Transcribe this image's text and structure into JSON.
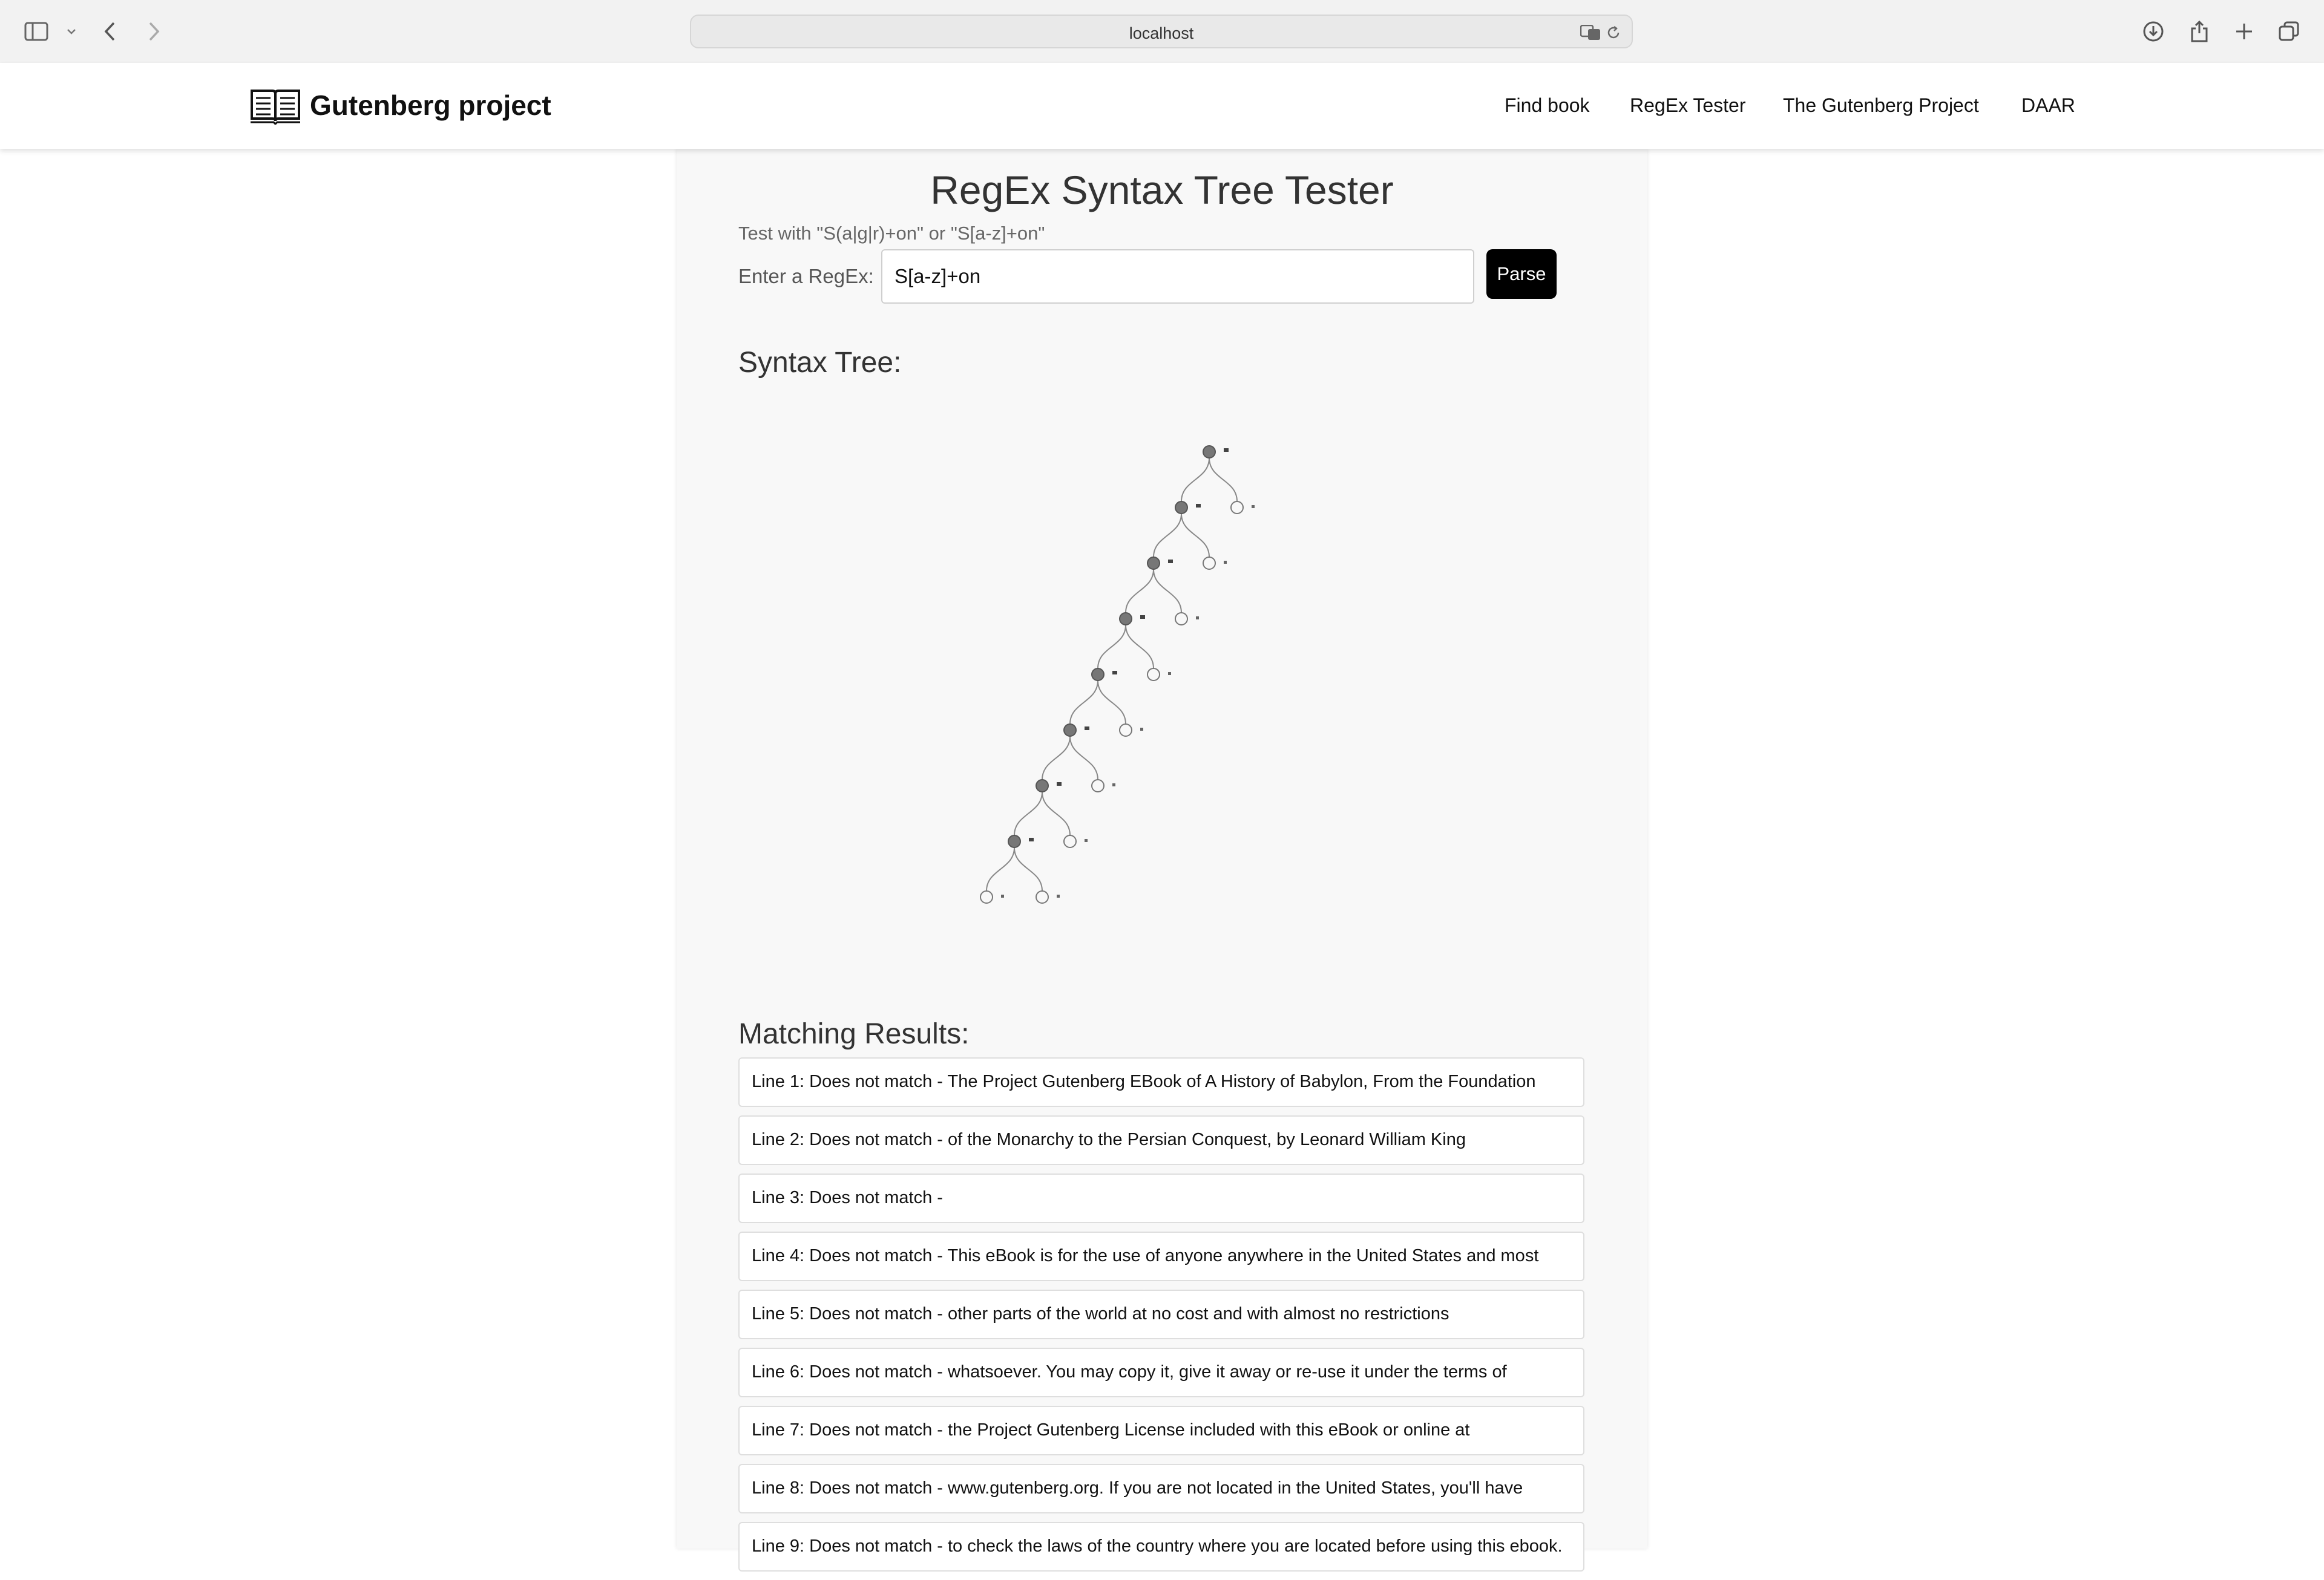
{
  "browser": {
    "url": "localhost"
  },
  "site": {
    "brand": "Gutenberg project",
    "nav": [
      {
        "label": "Find book"
      },
      {
        "label": "RegEx Tester"
      },
      {
        "label": "The Gutenberg Project"
      },
      {
        "label": "DAAR"
      }
    ]
  },
  "page": {
    "title": "RegEx Syntax Tree Tester",
    "hint": "Test with \"S(a|g|r)+on\" or \"S[a-z]+on\"",
    "regex_label": "Enter a RegEx:",
    "regex_value": "S[a-z]+on",
    "parse_label": "Parse",
    "tree_heading": "Syntax Tree:",
    "results_heading": "Matching Results:"
  },
  "tree": {
    "depth": 8,
    "fill_color": "#777777",
    "edge_color": "#888888"
  },
  "results": [
    "Line 1: Does not match - The Project Gutenberg EBook of A History of Babylon, From the Foundation",
    "Line 2: Does not match - of the Monarchy to the Persian Conquest, by Leonard William King",
    "Line 3: Does not match -",
    "Line 4: Does not match - This eBook is for the use of anyone anywhere in the United States and most",
    "Line 5: Does not match - other parts of the world at no cost and with almost no restrictions",
    "Line 6: Does not match - whatsoever. You may copy it, give it away or re-use it under the terms of",
    "Line 7: Does not match - the Project Gutenberg License included with this eBook or online at",
    "Line 8: Does not match - www.gutenberg.org. If you are not located in the United States, you'll have",
    "Line 9: Does not match - to check the laws of the country where you are located before using this ebook."
  ]
}
